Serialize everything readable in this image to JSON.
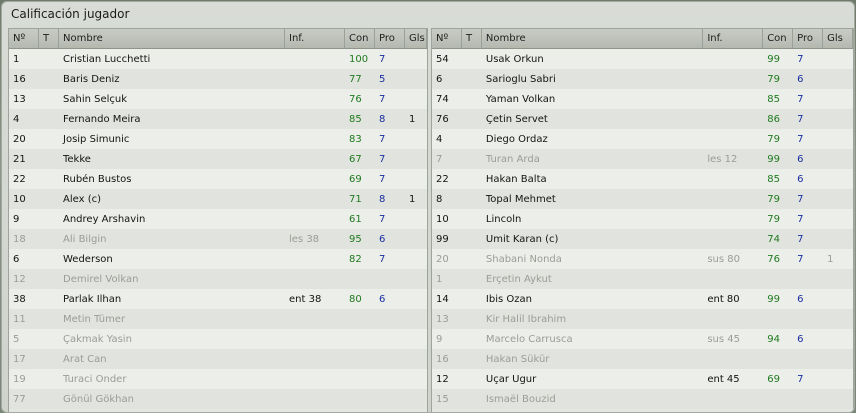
{
  "title": "Calificación jugador",
  "columns": {
    "no": "Nº",
    "t": "T",
    "name": "Nombre",
    "inf": "Inf.",
    "con": "Con",
    "pro": "Pro",
    "gls": "Gls"
  },
  "left": [
    {
      "no": "1",
      "name": "Cristian Lucchetti",
      "inf": "",
      "con": "100",
      "pro": "7",
      "gls": "",
      "icon": "",
      "dim": false
    },
    {
      "no": "16",
      "name": "Baris Deniz",
      "inf": "",
      "con": "77",
      "pro": "5",
      "gls": "",
      "icon": "",
      "dim": false
    },
    {
      "no": "13",
      "name": "Sahin Selçuk",
      "inf": "",
      "con": "76",
      "pro": "7",
      "gls": "",
      "icon": "",
      "dim": false
    },
    {
      "no": "4",
      "name": "Fernando Meira",
      "inf": "",
      "con": "85",
      "pro": "8",
      "gls": "1",
      "icon": "",
      "dim": false
    },
    {
      "no": "20",
      "name": "Josip Simunic",
      "inf": "",
      "con": "83",
      "pro": "7",
      "gls": "",
      "icon": "",
      "dim": false
    },
    {
      "no": "21",
      "name": "Tekke",
      "inf": "",
      "con": "67",
      "pro": "7",
      "gls": "",
      "icon": "",
      "dim": false
    },
    {
      "no": "22",
      "name": "Rubén Bustos",
      "inf": "",
      "con": "69",
      "pro": "7",
      "gls": "",
      "icon": "",
      "dim": false
    },
    {
      "no": "10",
      "name": "Alex (c)",
      "inf": "",
      "con": "71",
      "pro": "8",
      "gls": "1",
      "icon": "star",
      "dim": false
    },
    {
      "no": "9",
      "name": "Andrey Arshavin",
      "inf": "",
      "con": "61",
      "pro": "7",
      "gls": "",
      "icon": "",
      "dim": false
    },
    {
      "no": "18",
      "name": "Ali Bilgin",
      "inf": "les 38",
      "con": "95",
      "pro": "6",
      "gls": "",
      "icon": "injury",
      "dim": true
    },
    {
      "no": "6",
      "name": "Wederson",
      "inf": "",
      "con": "82",
      "pro": "7",
      "gls": "",
      "icon": "",
      "dim": false
    },
    {
      "no": "12",
      "name": "Demirel Volkan",
      "inf": "",
      "con": "",
      "pro": "",
      "gls": "",
      "icon": "",
      "dim": true
    },
    {
      "no": "38",
      "name": "Parlak Ilhan",
      "inf": "ent 38",
      "con": "80",
      "pro": "6",
      "gls": "",
      "icon": "",
      "dim": false
    },
    {
      "no": "11",
      "name": "Metin Tümer",
      "inf": "",
      "con": "",
      "pro": "",
      "gls": "",
      "icon": "",
      "dim": true
    },
    {
      "no": "5",
      "name": "Çakmak Yasin",
      "inf": "",
      "con": "",
      "pro": "",
      "gls": "",
      "icon": "",
      "dim": true
    },
    {
      "no": "17",
      "name": "Arat Can",
      "inf": "",
      "con": "",
      "pro": "",
      "gls": "",
      "icon": "",
      "dim": true
    },
    {
      "no": "19",
      "name": "Turaci Önder",
      "inf": "",
      "con": "",
      "pro": "",
      "gls": "",
      "icon": "",
      "dim": true
    },
    {
      "no": "77",
      "name": "Gönül Gökhan",
      "inf": "",
      "con": "",
      "pro": "",
      "gls": "",
      "icon": "",
      "dim": true
    }
  ],
  "right": [
    {
      "no": "54",
      "name": "Usak Orkun",
      "inf": "",
      "con": "99",
      "pro": "7",
      "gls": "",
      "icon": "",
      "dim": false
    },
    {
      "no": "6",
      "name": "Sarioglu Sabri",
      "inf": "",
      "con": "79",
      "pro": "6",
      "gls": "",
      "icon": "yellow-card",
      "dim": false
    },
    {
      "no": "74",
      "name": "Yaman Volkan",
      "inf": "",
      "con": "85",
      "pro": "7",
      "gls": "",
      "icon": "",
      "dim": false
    },
    {
      "no": "76",
      "name": "Çetin Servet",
      "inf": "",
      "con": "86",
      "pro": "7",
      "gls": "",
      "icon": "yellow-card",
      "dim": false
    },
    {
      "no": "4",
      "name": "Diego Ordaz",
      "inf": "",
      "con": "79",
      "pro": "7",
      "gls": "",
      "icon": "",
      "dim": false
    },
    {
      "no": "7",
      "name": "Turan Arda",
      "inf": "les 12",
      "con": "99",
      "pro": "6",
      "gls": "",
      "icon": "injury",
      "dim": true
    },
    {
      "no": "22",
      "name": "Hakan Balta",
      "inf": "",
      "con": "85",
      "pro": "6",
      "gls": "",
      "icon": "",
      "dim": false
    },
    {
      "no": "8",
      "name": "Topal Mehmet",
      "inf": "",
      "con": "79",
      "pro": "7",
      "gls": "",
      "icon": "",
      "dim": false
    },
    {
      "no": "10",
      "name": "Lincoln",
      "inf": "",
      "con": "79",
      "pro": "7",
      "gls": "",
      "icon": "",
      "dim": false
    },
    {
      "no": "99",
      "name": "Ümit Karan (c)",
      "inf": "",
      "con": "74",
      "pro": "7",
      "gls": "",
      "icon": "",
      "dim": false
    },
    {
      "no": "20",
      "name": "Shabani Nonda",
      "inf": "sus 80",
      "con": "76",
      "pro": "7",
      "gls": "1",
      "icon": "",
      "dim": true
    },
    {
      "no": "1",
      "name": "Erçetin Aykut",
      "inf": "",
      "con": "",
      "pro": "",
      "gls": "",
      "icon": "",
      "dim": true
    },
    {
      "no": "14",
      "name": "Ibis Ozan",
      "inf": "ent 80",
      "con": "99",
      "pro": "6",
      "gls": "",
      "icon": "",
      "dim": false
    },
    {
      "no": "13",
      "name": "Kir Halil Ibrahim",
      "inf": "",
      "con": "",
      "pro": "",
      "gls": "",
      "icon": "",
      "dim": true
    },
    {
      "no": "9",
      "name": "Marcelo Carrusca",
      "inf": "sus 45",
      "con": "94",
      "pro": "6",
      "gls": "",
      "icon": "",
      "dim": true
    },
    {
      "no": "16",
      "name": "Hakan Sükür",
      "inf": "",
      "con": "",
      "pro": "",
      "gls": "",
      "icon": "",
      "dim": true
    },
    {
      "no": "12",
      "name": "Uçar Ugur",
      "inf": "ent 45",
      "con": "69",
      "pro": "7",
      "gls": "",
      "icon": "",
      "dim": false
    },
    {
      "no": "15",
      "name": "Ismaël Bouzid",
      "inf": "",
      "con": "",
      "pro": "",
      "gls": "",
      "icon": "",
      "dim": true
    }
  ]
}
